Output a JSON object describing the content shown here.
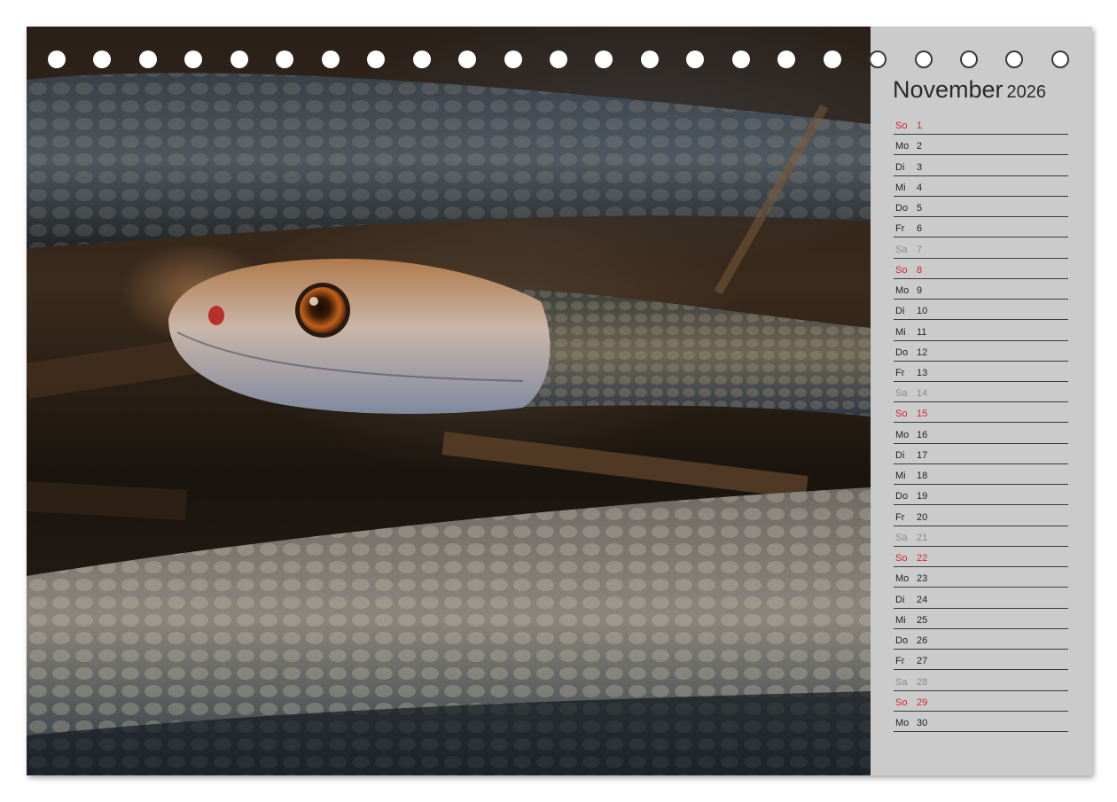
{
  "calendar": {
    "month": "November",
    "year": "2026",
    "days": [
      {
        "wd": "So",
        "d": "1",
        "type": "sunday"
      },
      {
        "wd": "Mo",
        "d": "2",
        "type": "weekday"
      },
      {
        "wd": "Di",
        "d": "3",
        "type": "weekday"
      },
      {
        "wd": "Mi",
        "d": "4",
        "type": "weekday"
      },
      {
        "wd": "Do",
        "d": "5",
        "type": "weekday"
      },
      {
        "wd": "Fr",
        "d": "6",
        "type": "weekday"
      },
      {
        "wd": "Sa",
        "d": "7",
        "type": "saturday"
      },
      {
        "wd": "So",
        "d": "8",
        "type": "sunday"
      },
      {
        "wd": "Mo",
        "d": "9",
        "type": "weekday"
      },
      {
        "wd": "Di",
        "d": "10",
        "type": "weekday"
      },
      {
        "wd": "Mi",
        "d": "11",
        "type": "weekday"
      },
      {
        "wd": "Do",
        "d": "12",
        "type": "weekday"
      },
      {
        "wd": "Fr",
        "d": "13",
        "type": "weekday"
      },
      {
        "wd": "Sa",
        "d": "14",
        "type": "saturday"
      },
      {
        "wd": "So",
        "d": "15",
        "type": "sunday"
      },
      {
        "wd": "Mo",
        "d": "16",
        "type": "weekday"
      },
      {
        "wd": "Di",
        "d": "17",
        "type": "weekday"
      },
      {
        "wd": "Mi",
        "d": "18",
        "type": "weekday"
      },
      {
        "wd": "Do",
        "d": "19",
        "type": "weekday"
      },
      {
        "wd": "Fr",
        "d": "20",
        "type": "weekday"
      },
      {
        "wd": "Sa",
        "d": "21",
        "type": "saturday"
      },
      {
        "wd": "So",
        "d": "22",
        "type": "sunday"
      },
      {
        "wd": "Mo",
        "d": "23",
        "type": "weekday"
      },
      {
        "wd": "Di",
        "d": "24",
        "type": "weekday"
      },
      {
        "wd": "Mi",
        "d": "25",
        "type": "weekday"
      },
      {
        "wd": "Do",
        "d": "26",
        "type": "weekday"
      },
      {
        "wd": "Fr",
        "d": "27",
        "type": "weekday"
      },
      {
        "wd": "Sa",
        "d": "28",
        "type": "saturday"
      },
      {
        "wd": "So",
        "d": "29",
        "type": "sunday"
      },
      {
        "wd": "Mo",
        "d": "30",
        "type": "weekday"
      }
    ]
  },
  "colors": {
    "sunday": "#d0262c",
    "saturday": "#8a8a8a",
    "panel_background": "#cbcbcb"
  },
  "photo": {
    "subject": "snake-photo"
  }
}
